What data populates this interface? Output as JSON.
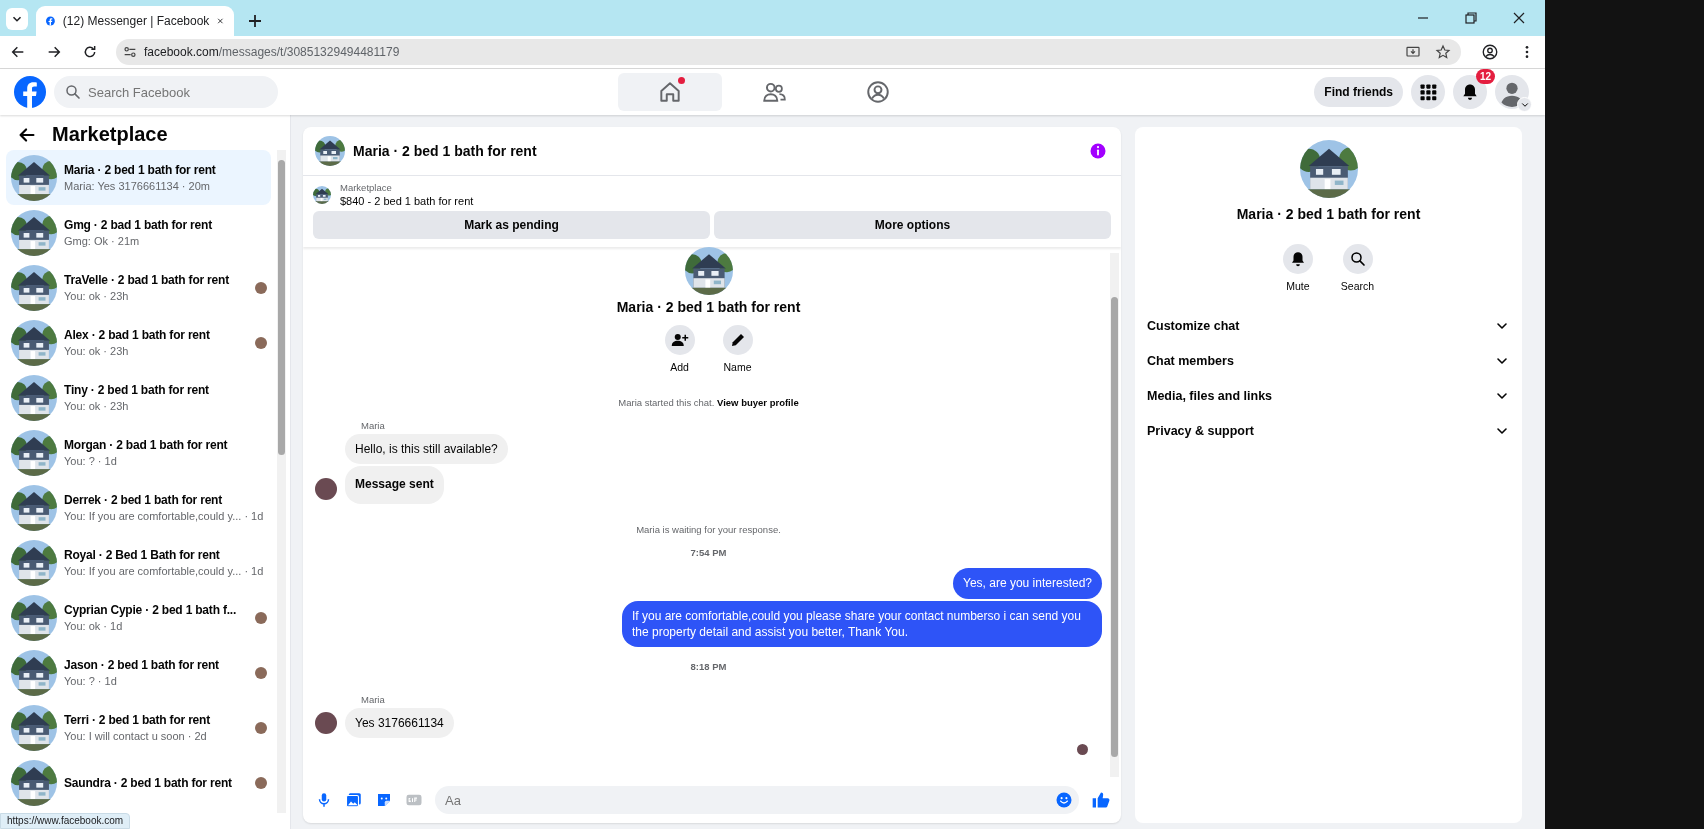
{
  "browser": {
    "tab_title": "(12) Messenger | Facebook",
    "url_domain": "facebook.com",
    "url_path": "/messages/t/30851329494481179",
    "status_link": "https://www.facebook.com"
  },
  "header": {
    "search_placeholder": "Search Facebook",
    "nav": [
      {
        "kind": "home",
        "selected": true,
        "dot": true
      },
      {
        "kind": "friends",
        "selected": false,
        "dot": false
      },
      {
        "kind": "groups",
        "selected": false,
        "dot": false
      }
    ],
    "find_friends": "Find friends",
    "notification_badge": "12"
  },
  "sidebar": {
    "title": "Marketplace",
    "items": [
      {
        "title": "Maria · 2 bed 1 bath for rent",
        "preview": "Maria: Yes 3176661134 · 20m",
        "selected": true,
        "seen_avatar": false
      },
      {
        "title": "Gmg · 2 bad 1 bath for rent",
        "preview": "Gmg: Ok · 21m",
        "selected": false,
        "seen_avatar": false
      },
      {
        "title": "TraVelle · 2 bad 1 bath for rent",
        "preview": "You: ok · 23h",
        "selected": false,
        "seen_avatar": true
      },
      {
        "title": "Alex · 2 bad 1 bath for rent",
        "preview": "You: ok · 23h",
        "selected": false,
        "seen_avatar": true
      },
      {
        "title": "Tiny · 2 bed 1 bath for rent",
        "preview": "You: ok · 23h",
        "selected": false,
        "seen_avatar": false
      },
      {
        "title": "Morgan · 2 bad 1 bath for rent",
        "preview": "You: ? · 1d",
        "selected": false,
        "seen_avatar": false
      },
      {
        "title": "Derrek · 2 bed 1 bath for rent",
        "preview": "You: If you are comfortable,could y...  · 1d",
        "selected": false,
        "seen_avatar": false
      },
      {
        "title": "Royal · 2 Bed 1 Bath for rent",
        "preview": "You: If you are comfortable,could y...  · 1d",
        "selected": false,
        "seen_avatar": false
      },
      {
        "title": "Cyprian Cypie · 2 bed 1 bath f...",
        "preview": "You: ok · 1d",
        "selected": false,
        "seen_avatar": true
      },
      {
        "title": "Jason · 2 bed 1 bath for rent",
        "preview": "You: ? · 1d",
        "selected": false,
        "seen_avatar": true
      },
      {
        "title": "Terri · 2 bed 1 bath for rent",
        "preview": "You: I will contact u soon · 2d",
        "selected": false,
        "seen_avatar": true
      },
      {
        "title": "Saundra · 2 bed 1 bath for rent",
        "selected": false,
        "seen_avatar": true
      }
    ]
  },
  "chat": {
    "title": "Maria · 2 bed 1 bath for rent",
    "listing": {
      "label": "Marketplace",
      "text": "$840 - 2 bed 1 bath for rent",
      "buttons": [
        "Mark as pending",
        "More options"
      ]
    },
    "intro": {
      "title": "Maria · 2 bed 1 bath for rent",
      "actions": [
        {
          "kind": "add",
          "label": "Add"
        },
        {
          "kind": "name",
          "label": "Name"
        }
      ],
      "notice": "Maria started this chat.",
      "link": "View buyer profile"
    },
    "messages": [
      {
        "kind": "sender",
        "text": "Maria"
      },
      {
        "kind": "incoming",
        "text": "Hello, is this still available?",
        "avatar": false,
        "bold": false
      },
      {
        "kind": "incoming",
        "text": "Message sent",
        "avatar": true,
        "bold": true
      },
      {
        "kind": "system",
        "text": "Maria is waiting for your response."
      },
      {
        "kind": "time",
        "text": "7:54 PM"
      },
      {
        "kind": "outgoing",
        "text": "Yes, are you interested?"
      },
      {
        "kind": "outgoing",
        "text": "If you are comfortable,could you please share your contact numberso i can send you the property detail and assist you better, Thank You."
      },
      {
        "kind": "time",
        "text": "8:18 PM"
      },
      {
        "kind": "sender",
        "text": "Maria"
      },
      {
        "kind": "incoming",
        "text": "Yes 3176661134",
        "avatar": true,
        "bold": false
      }
    ],
    "seen": true,
    "composer": {
      "placeholder": "Aa"
    }
  },
  "details": {
    "title": "Maria · 2 bed 1 bath for rent",
    "actions": [
      {
        "kind": "mute",
        "label": "Mute"
      },
      {
        "kind": "search",
        "label": "Search"
      }
    ],
    "sections": [
      {
        "label": "Customize chat",
        "expanded": false
      },
      {
        "label": "Chat members",
        "expanded": false
      },
      {
        "label": "Media, files and links",
        "expanded": false
      },
      {
        "label": "Privacy & support",
        "expanded": false
      }
    ]
  }
}
